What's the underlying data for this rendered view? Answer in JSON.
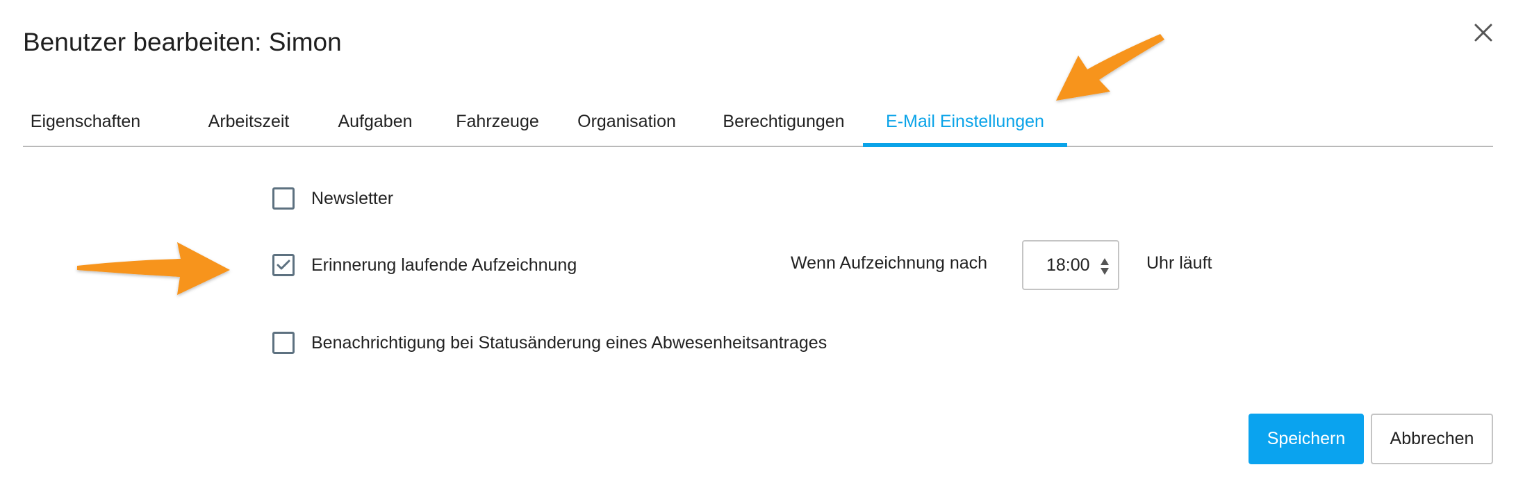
{
  "dialog": {
    "title": "Benutzer bearbeiten: Simon"
  },
  "tabs": [
    {
      "label": "Eigenschaften",
      "active": false
    },
    {
      "label": "Arbeitszeit",
      "active": false
    },
    {
      "label": "Aufgaben",
      "active": false
    },
    {
      "label": "Fahrzeuge",
      "active": false
    },
    {
      "label": "Organisation",
      "active": false
    },
    {
      "label": "Berechtigungen",
      "active": false
    },
    {
      "label": "E-Mail Einstellungen",
      "active": true
    }
  ],
  "settings": {
    "newsletter": {
      "label": "Newsletter",
      "checked": false
    },
    "reminder": {
      "label": "Erinnerung laufende Aufzeichnung",
      "checked": true,
      "condition_label": "Wenn Aufzeichnung nach",
      "time": "18:00",
      "suffix": "Uhr läuft"
    },
    "absence_notification": {
      "label": "Benachrichtigung bei Statusänderung eines Abwesenheitsantrages",
      "checked": false
    }
  },
  "buttons": {
    "save": "Speichern",
    "cancel": "Abbrechen"
  },
  "colors": {
    "accent": "#0aa3e8",
    "annotation_arrow": "#f7941d"
  },
  "icons": {
    "close": "close-icon",
    "check": "checkmark-icon",
    "spinner": "up-down-spinner-icon",
    "annotation": "orange-arrow-annotation"
  }
}
